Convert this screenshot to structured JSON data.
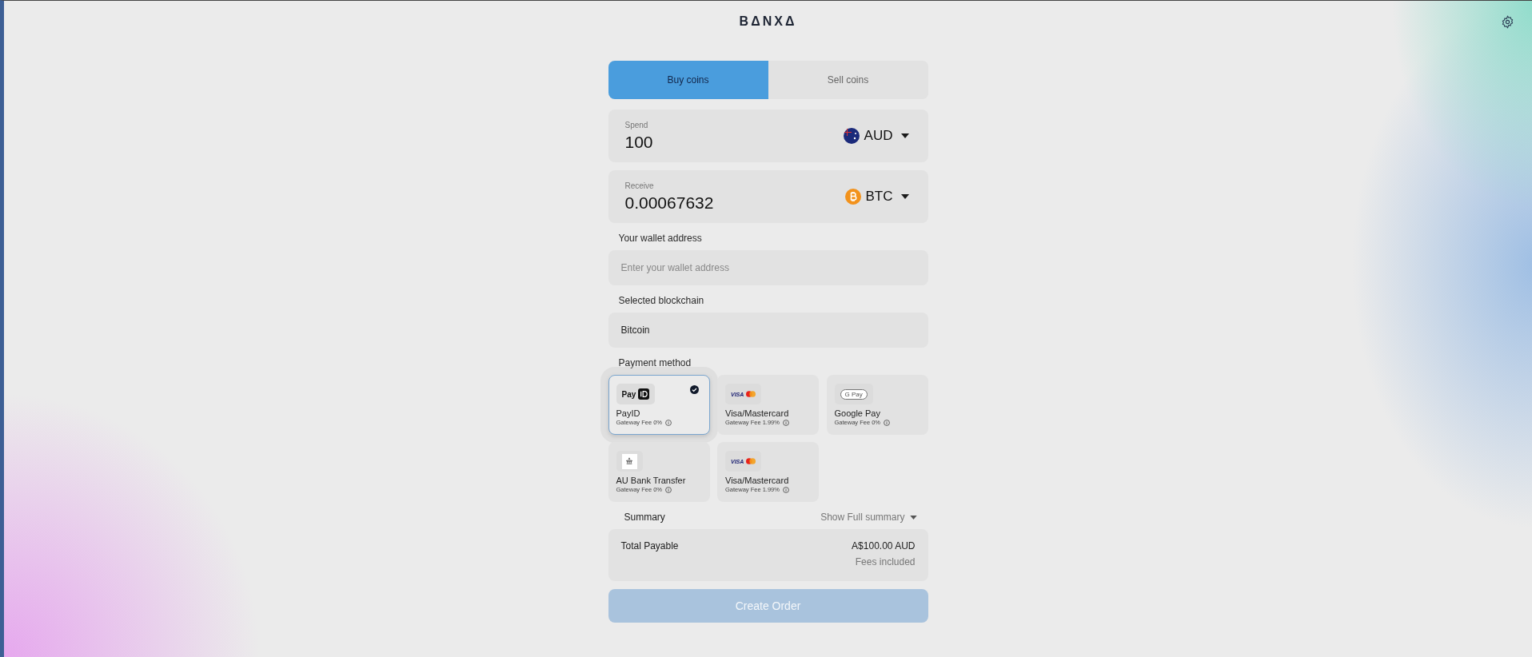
{
  "logo": "BΔNXΔ",
  "tabs": [
    {
      "label": "Buy coins",
      "selected": true
    },
    {
      "label": "Sell coins",
      "selected": false
    }
  ],
  "spend": {
    "label": "Spend",
    "value": "100",
    "currency": "AUD",
    "kind": "flag"
  },
  "receive": {
    "label": "Receive",
    "value": "0.00067632",
    "currency": "BTC",
    "kind": "bitcoin"
  },
  "wallet": {
    "label": "Your wallet address",
    "placeholder": "Enter your wallet address"
  },
  "blockchain": {
    "label": "Selected blockchain",
    "value": "Bitcoin"
  },
  "payment": {
    "label": "Payment method",
    "methods": [
      {
        "kind": "payid",
        "logo_text": "Pay",
        "name": "PayID",
        "fee": "Gateway Fee 0%",
        "selected": true
      },
      {
        "kind": "card",
        "logo_text": "VISA",
        "name": "Visa/Mastercard",
        "fee": "Gateway Fee 1.99%",
        "selected": false
      },
      {
        "kind": "gpay",
        "logo_text": "G Pay",
        "name": "Google Pay",
        "fee": "Gateway Fee 0%",
        "selected": false
      },
      {
        "kind": "bank",
        "name": "AU Bank Transfer",
        "fee": "Gateway Fee 0%",
        "selected": false
      },
      {
        "kind": "card",
        "logo_text": "VISA",
        "name": "Visa/Mastercard",
        "fee": "Gateway Fee 1.99%",
        "selected": false
      }
    ]
  },
  "summary": {
    "label": "Summary",
    "toggle": "Show Full summary",
    "total_label": "Total Payable",
    "total": "A$100.00 AUD",
    "note": "Fees included"
  },
  "submit": {
    "label": "Create Order",
    "disabled": true
  }
}
